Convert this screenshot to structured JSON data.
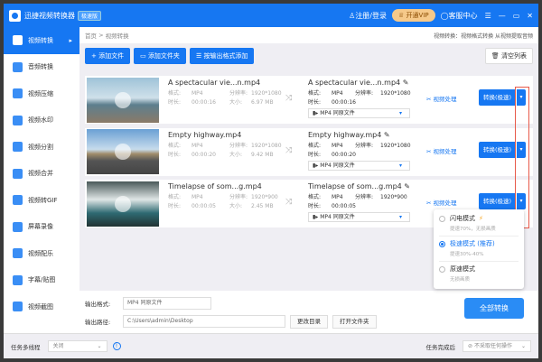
{
  "app": {
    "title": "迅捷视频转换器",
    "edition": "极速版",
    "login": "注册/登录",
    "vip": "开通VIP",
    "service": "客服中心"
  },
  "sidebar": [
    "视频转换",
    "音频转换",
    "视频压缩",
    "视频水印",
    "视频分割",
    "视频合并",
    "视频转GIF",
    "屏幕录像",
    "视频配乐",
    "字幕/贴图",
    "视频截图"
  ],
  "breadcrumb": {
    "home": "首页",
    "sep": ">",
    "current": "视频转换",
    "hint": "视频转换：视频格式转换 从视频提取音频"
  },
  "toolbar": {
    "add_file": "+ 添加文件",
    "add_folder": "添加文件夹",
    "add_by_format": "按输出格式添加",
    "clear": "清空列表"
  },
  "labels": {
    "format": "格式:",
    "resolution": "分辨率:",
    "duration": "时长:",
    "size": "大小:",
    "process": "视频处理",
    "convert": "转换(极速)",
    "output_select": "MP4  同原文件"
  },
  "files": [
    {
      "name": "A spectacular vie...n.mp4",
      "format": "MP4",
      "resolution": "1920*1080",
      "duration": "00:00:16",
      "size": "6.97 MB"
    },
    {
      "name": "Empty highway.mp4",
      "format": "MP4",
      "resolution": "1920*1080",
      "duration": "00:00:20",
      "size": "9.42 MB"
    },
    {
      "name": "Timelapse of som...g.mp4",
      "format": "MP4",
      "resolution": "1920*900",
      "duration": "00:00:05",
      "size": "2.45 MB"
    }
  ],
  "mode_menu": [
    {
      "title": "闪电模式",
      "sub": "提速70%，无损画质",
      "selected": false
    },
    {
      "title": "极速模式 (推荐)",
      "sub": "提速30%-40%",
      "selected": true
    },
    {
      "title": "原速模式",
      "sub": "无损画质",
      "selected": false
    }
  ],
  "bottom": {
    "format_label": "输出格式:",
    "format_value": "MP4  同原文件",
    "path_label": "输出路径:",
    "path_value": "C:\\Users\\admin\\Desktop",
    "change_dir": "更改目录",
    "open_folder": "打开文件夹",
    "convert_all": "全部转换"
  },
  "footer": {
    "multithread_label": "任务多线程",
    "multithread_value": "关闭",
    "after_label": "任务完成后",
    "after_value": "不采取任何操作"
  }
}
